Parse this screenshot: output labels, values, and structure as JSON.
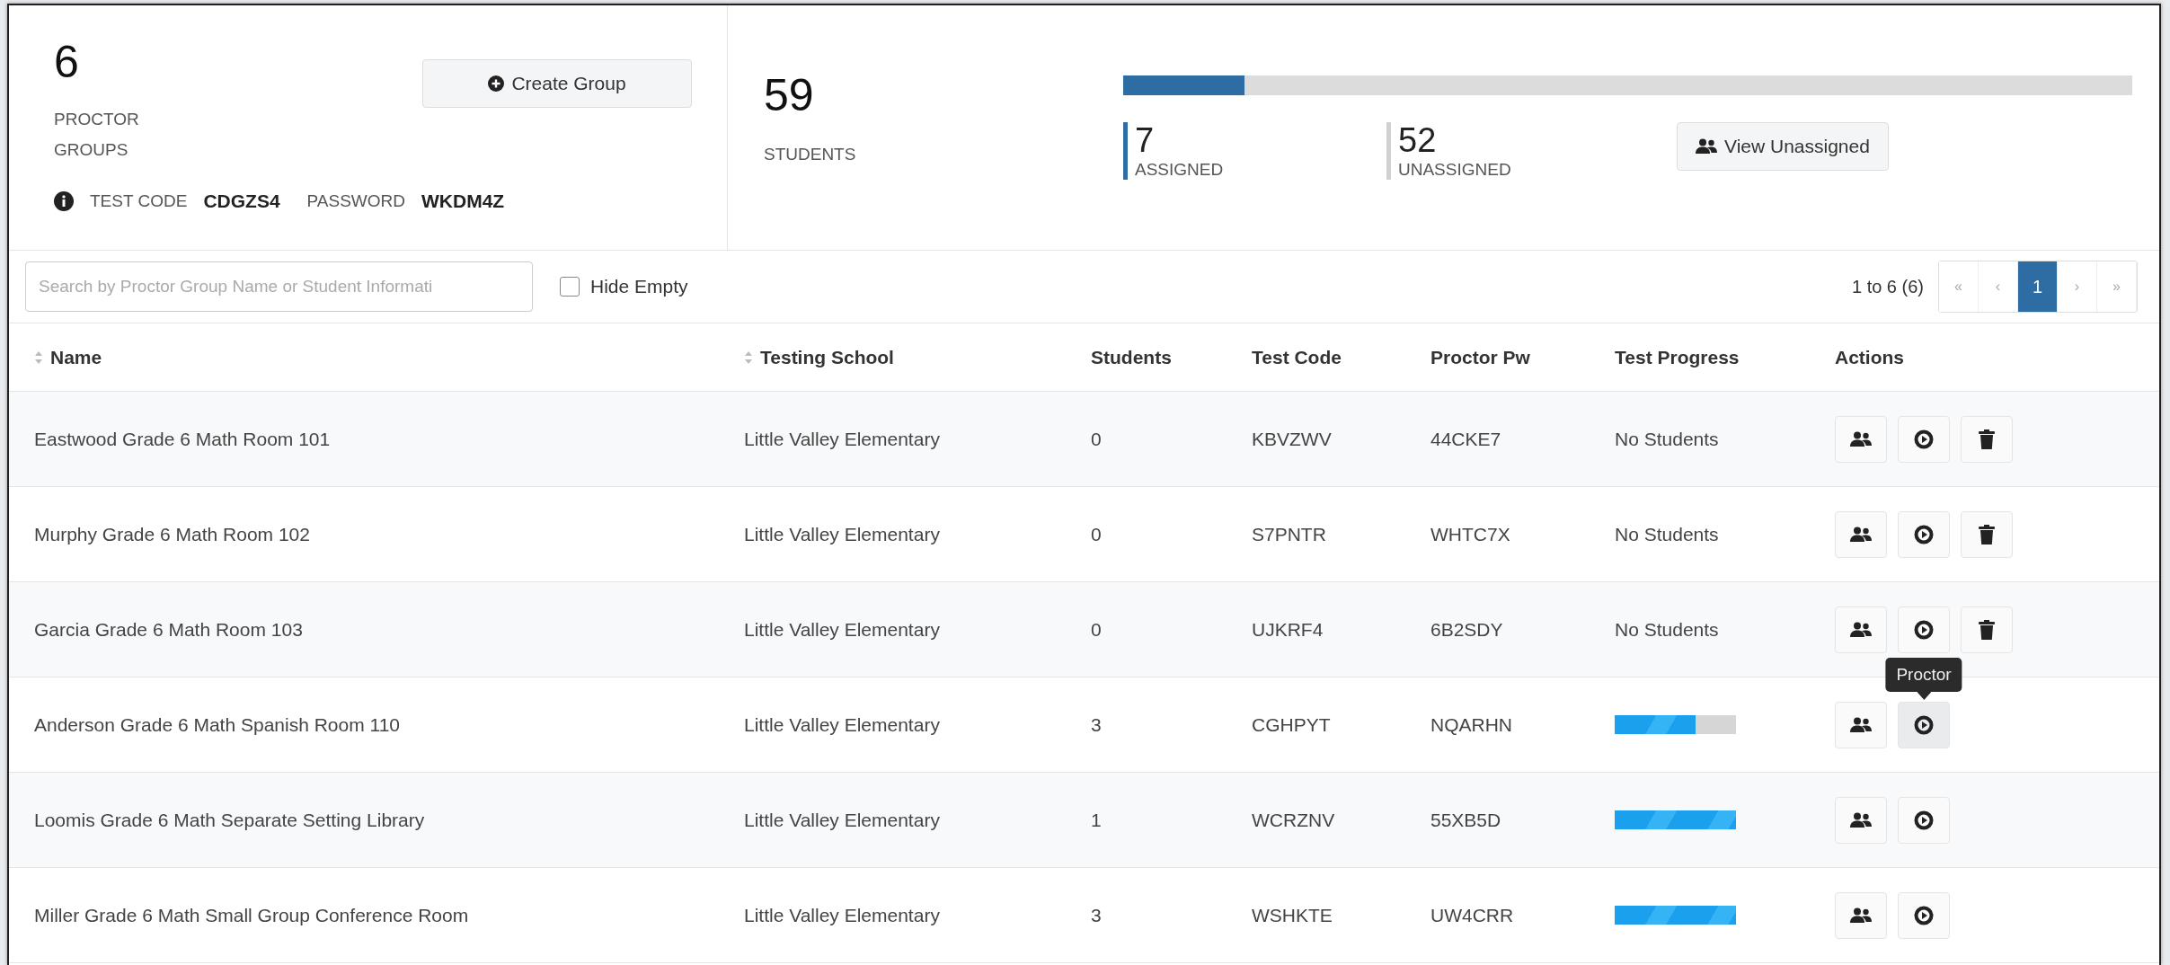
{
  "summary": {
    "groups_count": "6",
    "groups_label": "PROCTOR GROUPS",
    "create_button": "Create Group",
    "test_code_label": "TEST CODE",
    "test_code": "CDGZS4",
    "password_label": "PASSWORD",
    "password": "WKDM4Z"
  },
  "students": {
    "count": "59",
    "label": "STUDENTS",
    "level": 0.12,
    "assigned": {
      "count": "7",
      "label": "ASSIGNED"
    },
    "unassigned": {
      "count": "52",
      "label": "UNASSIGNED"
    },
    "view_button": "View Unassigned"
  },
  "toolbar": {
    "search": {
      "placeholder": "Search by Proctor Group Name or Student Informati"
    },
    "hide_empty": {
      "label": "Hide Empty",
      "checked": false
    },
    "range": "1 to 6 (6)",
    "pages": [
      {
        "label": "«",
        "selected": false
      },
      {
        "label": "‹",
        "selected": false
      },
      {
        "label": "1",
        "selected": true
      },
      {
        "label": "›",
        "selected": false
      },
      {
        "label": "»",
        "selected": false
      }
    ]
  },
  "table": {
    "columns": [
      {
        "label": "Name",
        "sortable": true
      },
      {
        "label": "Testing School",
        "sortable": true
      },
      {
        "label": "Students",
        "sortable": false
      },
      {
        "label": "Test Code",
        "sortable": false
      },
      {
        "label": "Proctor Pw",
        "sortable": false
      },
      {
        "label": "Test Progress",
        "sortable": false
      },
      {
        "label": "Actions",
        "sortable": false
      }
    ],
    "rows": [
      {
        "name": "Eastwood Grade 6 Math Room 101",
        "school": "Little Valley Elementary",
        "students": "0",
        "test_code": "KBVZWV",
        "proctor_pw": "44CKE7",
        "progress": {
          "kind": "text",
          "text": "No Students"
        },
        "actions": [
          {
            "kind": "students",
            "hovered": false
          },
          {
            "kind": "proctor",
            "hovered": false
          },
          {
            "kind": "delete",
            "hovered": false
          }
        ]
      },
      {
        "name": "Murphy Grade 6 Math Room 102",
        "school": "Little Valley Elementary",
        "students": "0",
        "test_code": "S7PNTR",
        "proctor_pw": "WHTC7X",
        "progress": {
          "kind": "text",
          "text": "No Students"
        },
        "actions": [
          {
            "kind": "students",
            "hovered": false
          },
          {
            "kind": "proctor",
            "hovered": false
          },
          {
            "kind": "delete",
            "hovered": false
          }
        ]
      },
      {
        "name": "Garcia Grade 6 Math Room 103",
        "school": "Little Valley Elementary",
        "students": "0",
        "test_code": "UJKRF4",
        "proctor_pw": "6B2SDY",
        "progress": {
          "kind": "text",
          "text": "No Students"
        },
        "actions": [
          {
            "kind": "students",
            "hovered": false
          },
          {
            "kind": "proctor",
            "hovered": false
          },
          {
            "kind": "delete",
            "hovered": false
          }
        ]
      },
      {
        "name": "Anderson Grade 6 Math Spanish Room 110",
        "school": "Little Valley Elementary",
        "students": "3",
        "test_code": "CGHPYT",
        "proctor_pw": "NQARHN",
        "progress": {
          "kind": "bar",
          "level": 0.67
        },
        "actions": [
          {
            "kind": "students",
            "hovered": false
          },
          {
            "kind": "proctor",
            "hovered": true,
            "tooltip": "Proctor"
          }
        ]
      },
      {
        "name": "Loomis Grade 6 Math Separate Setting Library",
        "school": "Little Valley Elementary",
        "students": "1",
        "test_code": "WCRZNV",
        "proctor_pw": "55XB5D",
        "progress": {
          "kind": "bar",
          "level": 1
        },
        "actions": [
          {
            "kind": "students",
            "hovered": false
          },
          {
            "kind": "proctor",
            "hovered": false
          }
        ]
      },
      {
        "name": "Miller Grade 6 Math Small Group Conference Room",
        "school": "Little Valley Elementary",
        "students": "3",
        "test_code": "WSHKTE",
        "proctor_pw": "UW4CRR",
        "progress": {
          "kind": "bar",
          "level": 1
        },
        "actions": [
          {
            "kind": "students",
            "hovered": false
          },
          {
            "kind": "proctor",
            "hovered": false
          }
        ]
      }
    ]
  }
}
